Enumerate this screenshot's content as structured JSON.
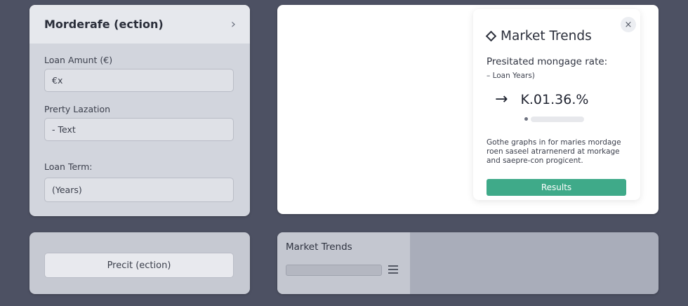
{
  "form": {
    "title": "Morderafe (ection)",
    "chevron_icon": "chevron-right-icon",
    "loan_amount_label": "Loan Amunt (€)",
    "loan_amount_value": "€x",
    "location_label": "Prerty Lazation",
    "location_value": "- Text",
    "term_label": "Loan Term:",
    "term_value": "(Years)"
  },
  "action": {
    "predict_label": "Precit (ection)"
  },
  "trend_card": {
    "title": "Market Trends",
    "title_icon": "diamond-icon",
    "close_label": "×",
    "predicted_label": "Presitated mongage rate:",
    "sub_label": "– Loan Years)",
    "arrow": "→",
    "rate_value": "K.01.36.%",
    "description": "Gothe graphs in for maries mordage roen saseel atrarnenerd at morkage and saepre-con progicent.",
    "results_label": "Results",
    "results_color": "#3faa89"
  },
  "bottom_panel": {
    "title": "Market Trends",
    "menu_icon": "menu-icon"
  }
}
